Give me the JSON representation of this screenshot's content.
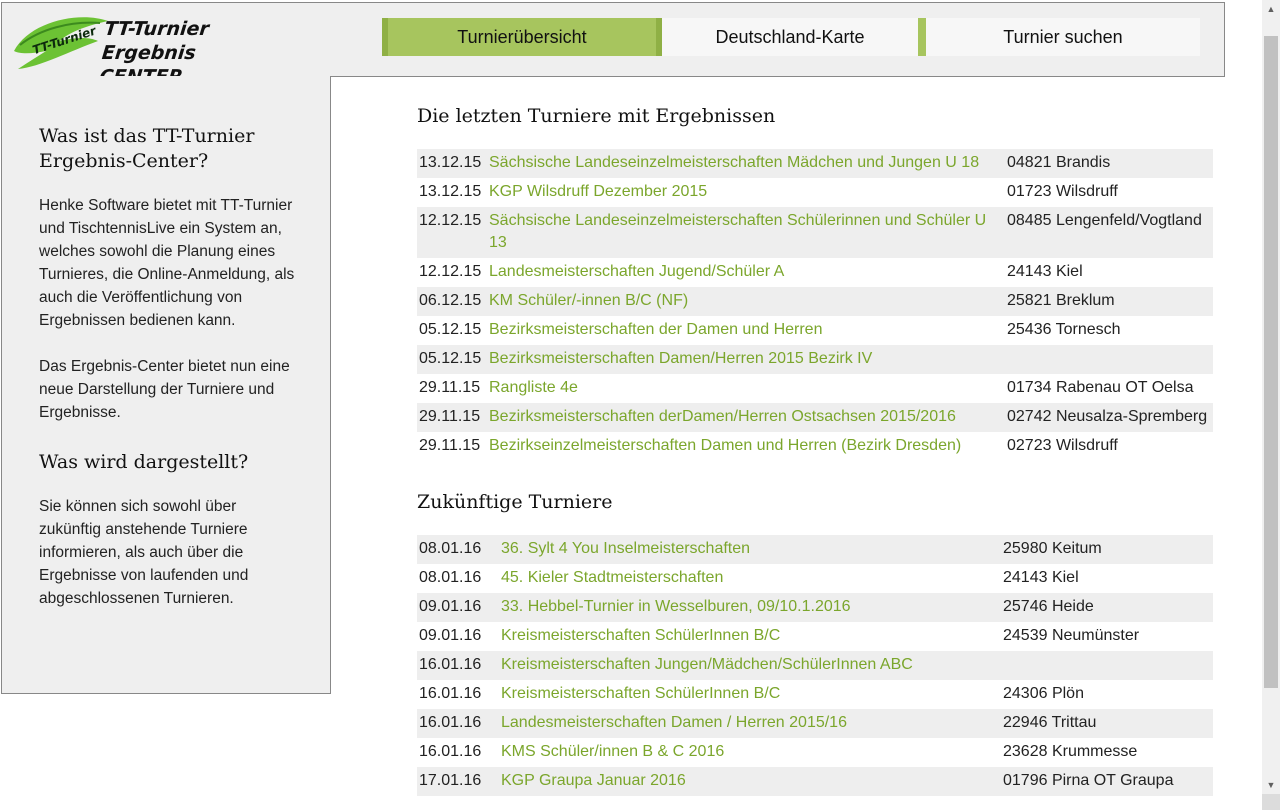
{
  "logo": {
    "badge": "TT-Turnier",
    "line1": "TT-Turnier",
    "line2": "Ergebnis CENTER"
  },
  "nav": [
    {
      "label": "Turnierübersicht",
      "active": true
    },
    {
      "label": "Deutschland-Karte",
      "active": false
    },
    {
      "label": "Turnier suchen",
      "active": false
    }
  ],
  "sidebar": {
    "heading1": "Was ist das TT-Turnier Ergebnis-Center?",
    "para1": "Henke Software bietet mit TT-Turnier und TischtennisLive ein System an, welches sowohl die Planung eines Turnieres, die Online-Anmeldung, als auch die Veröffentlichung von Ergebnissen bedienen kann.",
    "para2": "Das Ergebnis-Center bietet nun eine neue Darstellung der Turniere und Ergebnisse.",
    "heading2": "Was wird dargestellt?",
    "para3": "Sie können sich sowohl über zukünftig anstehende Turniere informieren, als auch über die Ergebnisse von laufenden und abgeschlossenen Turnieren."
  },
  "recent": {
    "title": "Die letzten Turniere mit Ergebnissen",
    "rows": [
      {
        "date": "13.12.15",
        "name": "Sächsische Landeseinzelmeisterschaften Mädchen und Jungen U 18",
        "place": "04821 Brandis"
      },
      {
        "date": "13.12.15",
        "name": "KGP Wilsdruff Dezember 2015",
        "place": "01723 Wilsdruff"
      },
      {
        "date": "12.12.15",
        "name": "Sächsische Landeseinzelmeisterschaften Schülerinnen und Schüler U 13",
        "place": "08485 Lengenfeld/Vogtland"
      },
      {
        "date": "12.12.15",
        "name": "Landesmeisterschaften Jugend/Schüler A",
        "place": "24143 Kiel"
      },
      {
        "date": "06.12.15",
        "name": "KM Schüler/-innen B/C (NF)",
        "place": "25821 Breklum"
      },
      {
        "date": "05.12.15",
        "name": "Bezirksmeisterschaften der Damen und Herren",
        "place": "25436 Tornesch"
      },
      {
        "date": "05.12.15",
        "name": "Bezirksmeisterschaften Damen/Herren 2015 Bezirk IV",
        "place": ""
      },
      {
        "date": "29.11.15",
        "name": "Rangliste 4e",
        "place": "01734 Rabenau OT Oelsa"
      },
      {
        "date": "29.11.15",
        "name": "Bezirksmeisterschaften derDamen/Herren Ostsachsen 2015/2016",
        "place": "02742 Neusalza-Spremberg"
      },
      {
        "date": "29.11.15",
        "name": "Bezirkseinzelmeisterschaften Damen und Herren (Bezirk Dresden)",
        "place": "02723 Wilsdruff"
      }
    ]
  },
  "upcoming": {
    "title": "Zukünftige Turniere",
    "rows": [
      {
        "date": "08.01.16",
        "name": "36. Sylt 4 You Inselmeisterschaften",
        "place": "25980 Keitum"
      },
      {
        "date": "08.01.16",
        "name": "45. Kieler Stadtmeisterschaften",
        "place": "24143 Kiel"
      },
      {
        "date": "09.01.16",
        "name": "33. Hebbel-Turnier in Wesselburen, 09/10.1.2016",
        "place": "25746 Heide"
      },
      {
        "date": "09.01.16",
        "name": "Kreismeisterschaften SchülerInnen B/C",
        "place": "24539 Neumünster"
      },
      {
        "date": "16.01.16",
        "name": "Kreismeisterschaften Jungen/Mädchen/SchülerInnen ABC",
        "place": ""
      },
      {
        "date": "16.01.16",
        "name": "Kreismeisterschaften SchülerInnen B/C",
        "place": "24306 Plön"
      },
      {
        "date": "16.01.16",
        "name": "Landesmeisterschaften Damen / Herren 2015/16",
        "place": "22946 Trittau"
      },
      {
        "date": "16.01.16",
        "name": "KMS Schüler/innen B & C 2016",
        "place": "23628 Krummesse"
      },
      {
        "date": "17.01.16",
        "name": "KGP Graupa Januar 2016",
        "place": "01796 Pirna OT Graupa"
      }
    ]
  },
  "colors": {
    "accent": "#a7c55e",
    "link": "#7ba62c",
    "panel": "#efefef"
  }
}
